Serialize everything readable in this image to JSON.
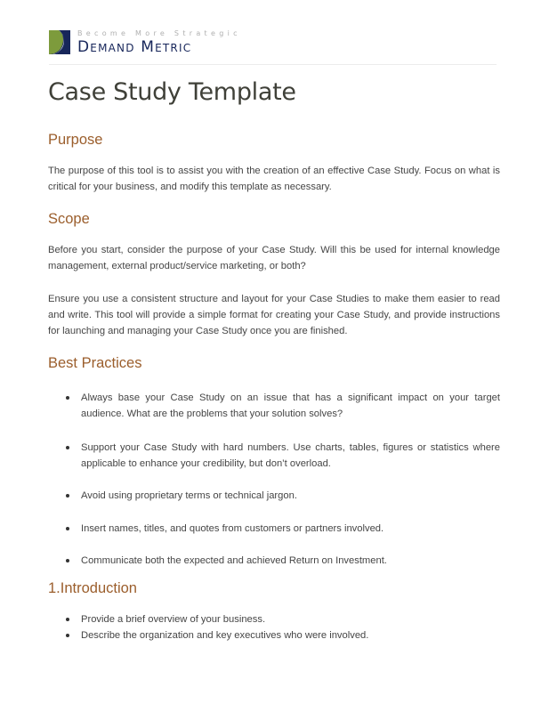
{
  "header": {
    "logo_icon": "demand-metric-logo-mark",
    "tagline": "Become More Strategic",
    "brand": "Demand Metric"
  },
  "document": {
    "title": "Case Study Template",
    "sections": {
      "purpose": {
        "heading": "Purpose",
        "paragraphs": [
          "The purpose of this tool is to assist you with the creation of an effective Case Study.  Focus on what is critical for your business, and modify this template as necessary."
        ]
      },
      "scope": {
        "heading": "Scope",
        "paragraphs": [
          "Before you start, consider the purpose of your Case Study.  Will this be used for internal knowledge management, external product/service marketing, or both?",
          "Ensure you use a consistent structure and layout for your Case Studies to make them easier to read and write. This tool will provide a simple format for creating your Case Study, and provide instructions for launching and managing your Case Study once you are finished."
        ]
      },
      "best_practices": {
        "heading": "Best Practices",
        "bullets": [
          "Always base your Case Study on an issue that has a significant impact on your target audience.  What are the problems that your solution solves?",
          "Support your Case Study with hard numbers.  Use charts, tables, figures or statistics where applicable to enhance your credibility, but don’t overload.",
          "Avoid using proprietary terms or technical jargon.",
          "Insert names, titles, and quotes from customers or partners involved.",
          "Communicate both the expected and achieved Return on Investment."
        ]
      },
      "introduction": {
        "heading": "1.Introduction",
        "bullets": [
          "Provide a brief overview of your business.",
          "Describe the organization and key executives who were involved."
        ]
      }
    }
  },
  "colors": {
    "heading": "#9b5e2c",
    "title": "#3f4038",
    "body": "#454545",
    "brand_navy": "#17265a",
    "brand_green": "#7a9a3a"
  }
}
